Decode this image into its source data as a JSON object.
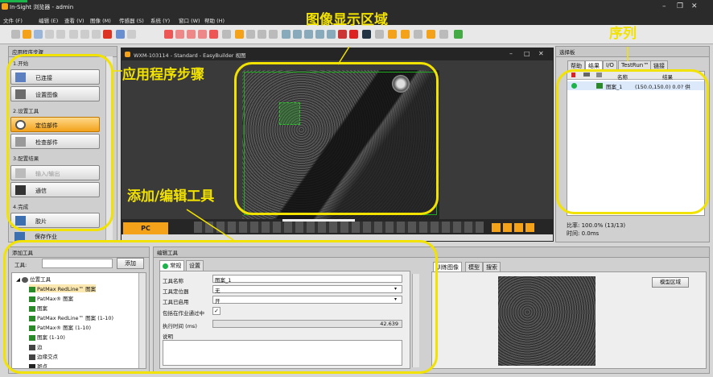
{
  "window": {
    "title": "In-Sight 浏览器 - admin"
  },
  "menu": [
    "文件 (F)",
    "编辑 (E)",
    "查看 (V)",
    "图像 (M)",
    "传感器 (S)",
    "系统 (Y)",
    "窗口 (W)",
    "帮助 (H)"
  ],
  "steps": {
    "header": "应用程序步骤",
    "sections": [
      {
        "title": "1.开始",
        "items": [
          "已连接",
          "设置图像"
        ]
      },
      {
        "title": "2.设置工具",
        "items": [
          "定位部件",
          "检查部件"
        ]
      },
      {
        "title": "3.配置结果",
        "items": [
          "输入/输出",
          "通信"
        ]
      },
      {
        "title": "4.完成",
        "items": [
          "胶片",
          "保存作业"
        ]
      }
    ]
  },
  "image_window": {
    "title": "WXM-103114 - Standard - EasyBuilder 视图",
    "pc_label": "PC"
  },
  "palette": {
    "header": "选择板",
    "tabs": [
      "帮助",
      "结果",
      "I/O",
      "TestRun™",
      "链接"
    ],
    "columns": [
      "名称",
      "结果"
    ],
    "rows": [
      {
        "name": "图案_1",
        "result": "(150.0,150.0) 0.0? 供"
      }
    ],
    "ratio": "比率: 100.0% (13/13)",
    "time": "时间: 0.0ms"
  },
  "add_tool": {
    "header": "添加工具",
    "tool_label": "工具:",
    "add_button": "添加",
    "tree": [
      {
        "label": "位置工具",
        "level": 0
      },
      {
        "label": "PatMax RedLine™ 图案",
        "level": 1
      },
      {
        "label": "PatMax® 图案",
        "level": 1
      },
      {
        "label": "图案",
        "level": 1
      },
      {
        "label": "PatMax RedLine™ 图案 (1-10)",
        "level": 1
      },
      {
        "label": "PatMax® 图案 (1-10)",
        "level": 1
      },
      {
        "label": "图案 (1-10)",
        "level": 1
      },
      {
        "label": "边",
        "level": 1
      },
      {
        "label": "边缘交点",
        "level": 1
      },
      {
        "label": "斑点",
        "level": 1
      }
    ]
  },
  "edit_tool": {
    "header": "编辑工具",
    "tabs": [
      "常规",
      "设置"
    ],
    "fields": [
      {
        "label": "工具名称",
        "value": "图案_1"
      },
      {
        "label": "工具定位器",
        "value": "无"
      },
      {
        "label": "工具已启用",
        "value": "开"
      },
      {
        "label": "包括在作业通过中",
        "value": "✓"
      },
      {
        "label": "执行时间 (ms)",
        "value": "42.639"
      },
      {
        "label": "说明",
        "value": ""
      }
    ]
  },
  "train": {
    "tabs": [
      "训练图像",
      "模型",
      "搜索"
    ],
    "model_region_button": "模型区域"
  },
  "annotations": {
    "image_area": "图像显示区域",
    "steps": "应用程序步骤",
    "sequence": "序列",
    "add_edit": "添加/编辑工具"
  },
  "colors": {
    "highlight": "#f2e200",
    "accent": "#f3a21a",
    "status_ok": "#1bb34a"
  }
}
